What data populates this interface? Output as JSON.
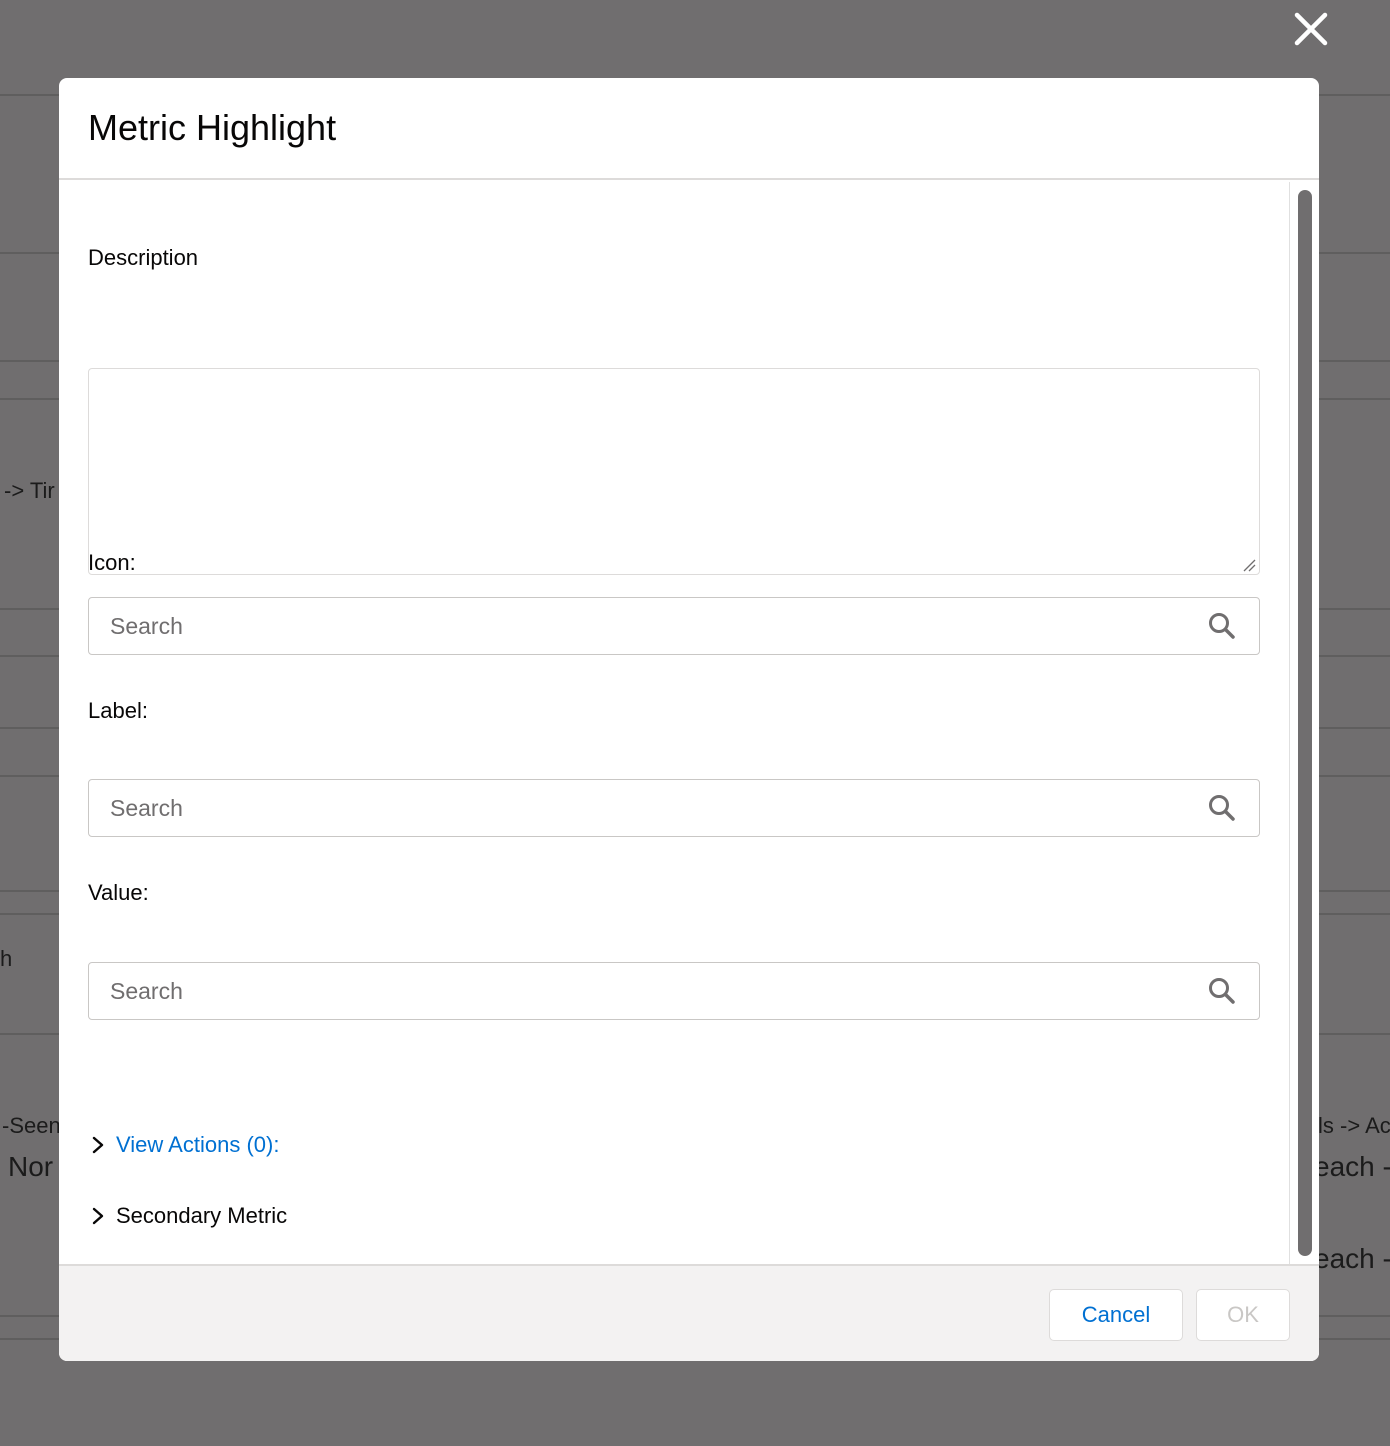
{
  "background": {
    "fragments": [
      "-> Tir",
      "h",
      "-Seen",
      "Nor",
      "ls -> Ac",
      "each -",
      "each -"
    ]
  },
  "modal": {
    "title": "Metric Highlight",
    "description": {
      "label": "Description",
      "value": ""
    },
    "icon": {
      "label": "Icon:",
      "placeholder": "Search"
    },
    "label_field": {
      "label": "Label:",
      "placeholder": "Search"
    },
    "value_field": {
      "label": "Value:",
      "placeholder": "Search"
    },
    "view_actions": {
      "label": "View Actions (0):"
    },
    "secondary_metric": {
      "label": "Secondary Metric"
    },
    "footer": {
      "cancel": "Cancel",
      "ok": "OK"
    }
  },
  "colors": {
    "link": "#0070d2",
    "overlay": "#706e6f",
    "disabled": "#c9c7c5"
  }
}
